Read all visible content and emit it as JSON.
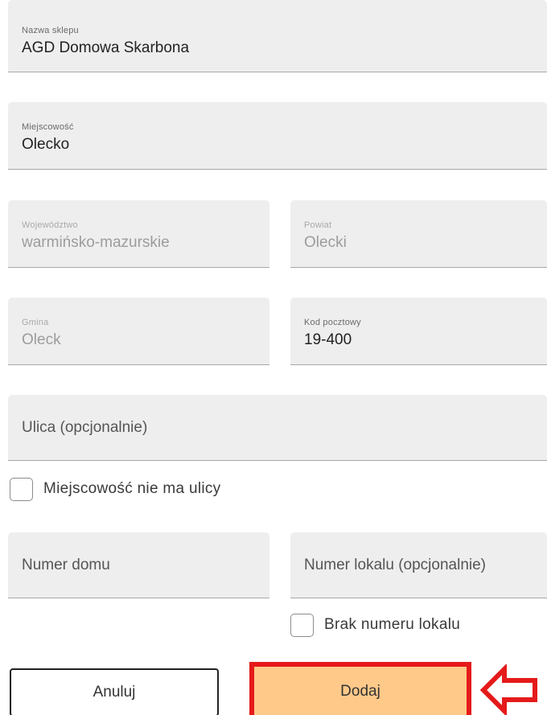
{
  "form": {
    "shop_name": {
      "label": "Nazwa sklepu",
      "value": "AGD Domowa Skarbona"
    },
    "city": {
      "label": "Miejscowość",
      "value": "Olecko"
    },
    "voivodeship": {
      "label": "Województwo",
      "value": "warmińsko-mazurskie"
    },
    "county": {
      "label": "Powiat",
      "value": "Olecki"
    },
    "municipality": {
      "label": "Gmina",
      "value": "Oleck"
    },
    "postal_code": {
      "label": "Kod pocztowy",
      "value": "19-400"
    },
    "street": {
      "placeholder": "Ulica (opcjonalnie)"
    },
    "no_street": {
      "label": "Miejscowość nie ma ulicy",
      "checked": false
    },
    "house_number": {
      "placeholder": "Numer domu"
    },
    "apartment_number": {
      "placeholder": "Numer lokalu (opcjonalnie)"
    },
    "no_apartment": {
      "label": "Brak numeru lokalu",
      "checked": false
    }
  },
  "actions": {
    "cancel_label": "Anuluj",
    "add_label": "Dodaj"
  },
  "colors": {
    "field_bg": "#eeeeee",
    "add_button_bg": "#ffc98a",
    "highlight_red": "#e51a1a"
  },
  "annotations": {
    "highlight_icon": "arrow-left-outline-icon"
  }
}
